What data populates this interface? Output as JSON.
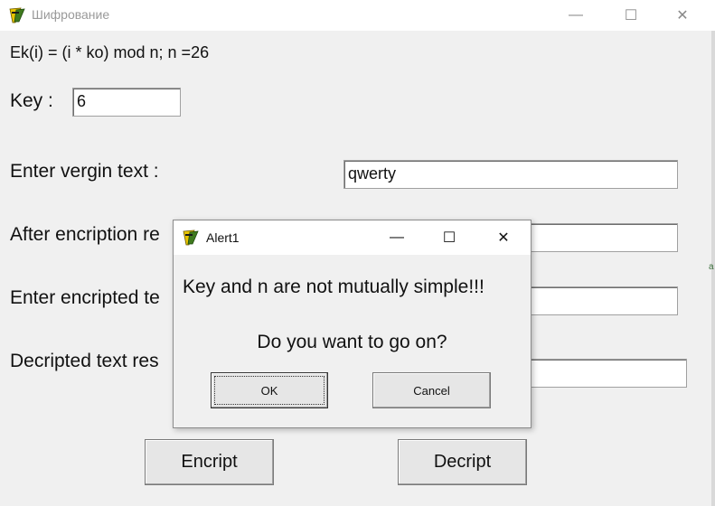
{
  "window": {
    "title": "Шифрование",
    "min_glyph": "—",
    "max_glyph": "☐",
    "close_glyph": "✕"
  },
  "form": {
    "formula": "Ek(i) = (i * ko) mod n; n =26",
    "key_label": "Key :",
    "key_value": "6",
    "vergin_label": "Enter vergin text :",
    "vergin_value": "qwerty",
    "after_label": "After encription re",
    "after_value": "",
    "encr_label": "Enter encripted te",
    "encr_value": "",
    "decr_label": "Decripted text res",
    "decr_value": "",
    "encript_button": "Encript",
    "decript_button": "Decript"
  },
  "dialog": {
    "title": "Alert1",
    "message1": "Key and n are not mutually simple!!!",
    "message2": "Do you want to go on?",
    "ok_label": "OK",
    "cancel_label": "Cancel",
    "min_glyph": "—",
    "max_glyph": "☐",
    "close_glyph": "✕"
  },
  "colors": {
    "window_bg": "#f0f0f0",
    "titlebar_bg": "#ffffff",
    "icon_yellow": "#e8c400",
    "icon_green": "#3f7a1e"
  },
  "icons": {
    "app": "delphi-app-icon",
    "dialog": "delphi-app-icon"
  },
  "side_mark": "a"
}
